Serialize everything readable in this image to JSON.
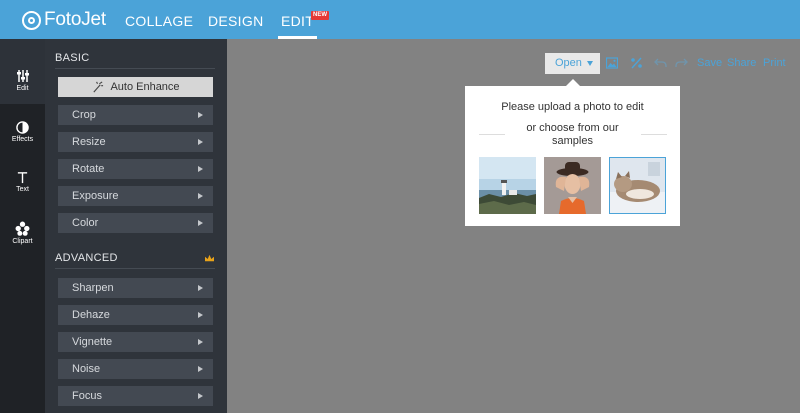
{
  "brand": {
    "name": "FotoJet"
  },
  "nav": {
    "collage": "COLLAGE",
    "design": "DESIGN",
    "edit": "EDIT",
    "badge": "NEW"
  },
  "rail": [
    {
      "label": "Edit",
      "icon": "sliders-icon"
    },
    {
      "label": "Effects",
      "icon": "contrast-icon"
    },
    {
      "label": "Text",
      "icon": "text-icon"
    },
    {
      "label": "Clipart",
      "icon": "clipart-icon"
    }
  ],
  "panel": {
    "basic_title": "BASIC",
    "auto_enhance": "Auto Enhance",
    "basic_tools": [
      "Crop",
      "Resize",
      "Rotate",
      "Exposure",
      "Color"
    ],
    "advanced_title": "ADVANCED",
    "advanced_tools": [
      "Sharpen",
      "Dehaze",
      "Vignette",
      "Noise",
      "Focus"
    ]
  },
  "toolbar": {
    "open": "Open",
    "save": "Save",
    "share": "Share",
    "print": "Print"
  },
  "popup": {
    "title": "Please upload a photo to edit",
    "choose": "or choose from our samples",
    "samples": [
      "lighthouse-coast",
      "woman-with-hat",
      "cat-on-blanket"
    ]
  },
  "colors": {
    "accent": "#4ba3d8",
    "rail": "#1f2226",
    "panel": "#2f343b",
    "canvas": "#828282",
    "badge": "#e53935"
  }
}
